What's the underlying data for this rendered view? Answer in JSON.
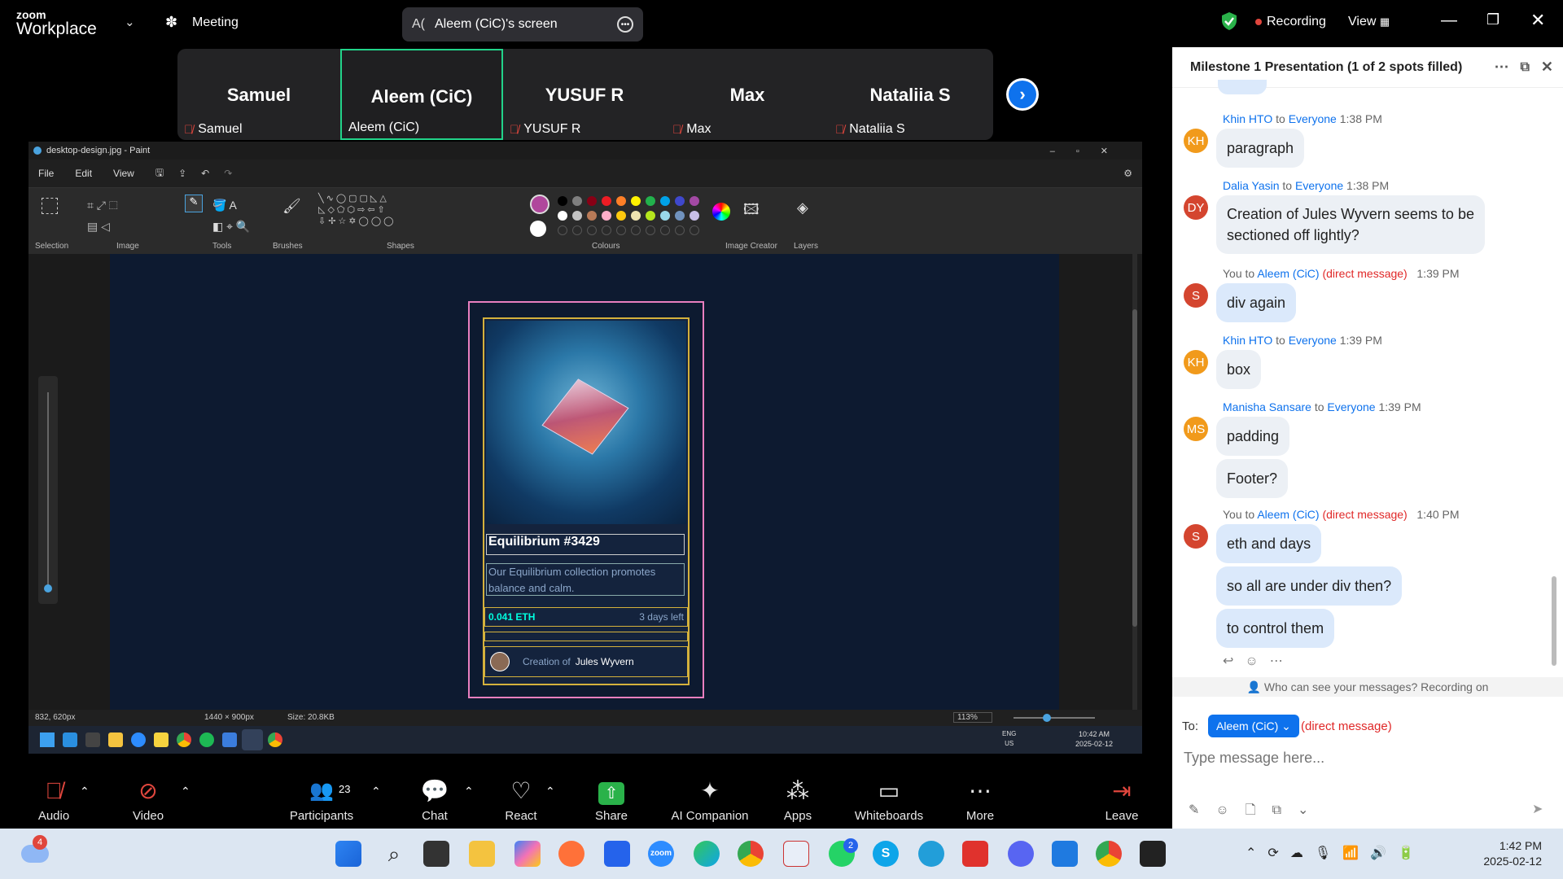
{
  "zoom_top": {
    "brand_small": "zoom",
    "brand_large": "Workplace",
    "meeting_label": "Meeting",
    "share_prefix": "A(",
    "share_label": "Aleem (CiC)'s screen",
    "recording_label": "Recording",
    "view_label": "View"
  },
  "gallery": {
    "tiles": [
      {
        "display": "Samuel",
        "name": "Samuel",
        "muted": true,
        "active": false
      },
      {
        "display": "Aleem (CiC)",
        "name": "Aleem (CiC)",
        "muted": false,
        "active": true
      },
      {
        "display": "YUSUF R",
        "name": "YUSUF R",
        "muted": true,
        "active": false
      },
      {
        "display": "Max",
        "name": "Max",
        "muted": true,
        "active": false
      },
      {
        "display": "Nataliia S",
        "name": "Nataliia S",
        "muted": true,
        "active": false
      }
    ]
  },
  "paint": {
    "title": "desktop-design.jpg - Paint",
    "menu": [
      "File",
      "Edit",
      "View"
    ],
    "groups": [
      "Selection",
      "Image",
      "Tools",
      "Brushes",
      "Shapes",
      "Colours",
      "Image Creator",
      "Layers"
    ],
    "status": {
      "cursor": "832, 620px",
      "dimensions": "1440 × 900px",
      "size": "Size: 20.8KB",
      "zoom": "113%"
    },
    "palette": [
      "#000000",
      "#7f7f7f",
      "#880015",
      "#ed1c24",
      "#ff7f27",
      "#fff200",
      "#22b14c",
      "#00a2e8",
      "#3f48cc",
      "#a349a4",
      "#ffffff",
      "#c3c3c3",
      "#b97a57",
      "#ffaec9",
      "#ffc90e",
      "#efe4b0",
      "#b5e61d",
      "#99d9ea",
      "#7092be",
      "#c8bfe7"
    ],
    "primary_color": "#b0479c",
    "card": {
      "title": "Equilibrium #3429",
      "description": "Our Equilibrium collection promotes balance and calm.",
      "price": "0.041 ETH",
      "time_left": "3 days left",
      "creation_prefix": "Creation of",
      "creator": "Jules Wyvern"
    },
    "taskbar_clock": {
      "time": "10:42 AM",
      "date": "2025-02-12",
      "lang1": "ENG",
      "lang2": "US"
    }
  },
  "zoom_toolbar": {
    "audio": "Audio",
    "video": "Video",
    "participants": "Participants",
    "participants_count": "23",
    "chat": "Chat",
    "react": "React",
    "share": "Share",
    "ai_companion": "AI Companion",
    "apps": "Apps",
    "whiteboards": "Whiteboards",
    "more": "More",
    "leave": "Leave"
  },
  "chat": {
    "title": "Milestone 1 Presentation (1 of 2 spots filled)",
    "messages": [
      {
        "from": "Khin HTO",
        "to": "Everyone",
        "time": "1:38 PM",
        "initials": "KH",
        "color": "#f19a1b",
        "lines": [
          "paragraph"
        ]
      },
      {
        "from": "Dalia Yasin",
        "to": "Everyone",
        "time": "1:38 PM",
        "initials": "DY",
        "color": "#d4452f",
        "lines": [
          "Creation of Jules Wyvern seems to be",
          "sectioned off lightly?"
        ]
      },
      {
        "from": "You",
        "to": "Aleem (CiC)",
        "dm": "(direct message)",
        "time": "1:39 PM",
        "initials": "S",
        "color": "#d4452f",
        "lines": [
          "div again"
        ]
      },
      {
        "from": "Khin HTO",
        "to": "Everyone",
        "time": "1:39 PM",
        "initials": "KH",
        "color": "#f19a1b",
        "lines": [
          "box"
        ]
      },
      {
        "from": "Manisha Sansare",
        "to": "Everyone",
        "time": "1:39 PM",
        "initials": "MS",
        "color": "#f19a1b",
        "lines": [
          "padding",
          "Footer?"
        ]
      },
      {
        "from": "You",
        "to": "Aleem (CiC)",
        "dm": "(direct message)",
        "time": "1:40 PM",
        "initials": "S",
        "color": "#d4452f",
        "lines": [
          "eth and days",
          "so all are under div then?",
          "to control them"
        ]
      }
    ],
    "to_word": "to",
    "privacy_note": "Who can see your messages? Recording on",
    "to_label": "To:",
    "recipient": "Aleem (CiC)",
    "recipient_note": "(direct message)",
    "input_placeholder": "Type message here..."
  },
  "windows": {
    "time": "1:42 PM",
    "date": "2025-02-12",
    "weather_badge": "4",
    "whatsapp_badge": "2"
  }
}
